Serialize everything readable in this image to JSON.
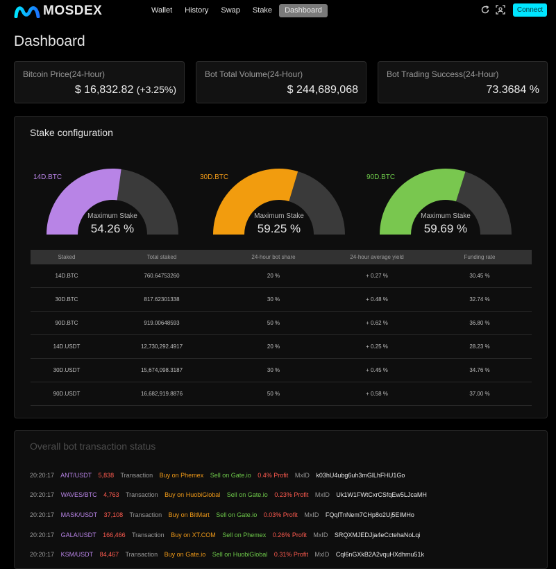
{
  "brand": {
    "name": "MOSDEX",
    "logo_icon": "m-wave-logo",
    "accent": "#00e5ff"
  },
  "nav": {
    "items": [
      "Wallet",
      "History",
      "Swap",
      "Stake",
      "Dashboard"
    ],
    "active": "Dashboard"
  },
  "header": {
    "refresh_icon": "refresh-icon",
    "scan_icon": "scan-icon",
    "connect_label": "Connect"
  },
  "page": {
    "title": "Dashboard"
  },
  "stats": {
    "bitcoin_price": {
      "label": "Bitcoin Price(24-Hour)",
      "value": "$ 16,832.82",
      "change": "(+3.25%)"
    },
    "bot_volume": {
      "label": "Bot Total Volume(24-Hour)",
      "value": "$ 244,689,068"
    },
    "bot_success": {
      "label": "Bot Trading Success(24-Hour)",
      "value": "73.3684 %"
    }
  },
  "stake": {
    "title": "Stake configuration",
    "caption": "Maximum Stake",
    "gauges": [
      {
        "label": "14D.BTC",
        "value": "54.26 %",
        "percent": 54.26,
        "color": "#b884e6"
      },
      {
        "label": "30D.BTC",
        "value": "59.25 %",
        "percent": 59.25,
        "color": "#f29c0e"
      },
      {
        "label": "90D.BTC",
        "value": "59.69 %",
        "percent": 59.69,
        "color": "#79c74f"
      }
    ],
    "gauge_track_color": "#3a3a3a",
    "columns": [
      "Staked",
      "Total staked",
      "24-hour bot share",
      "24-hour average yield",
      "Funding rate"
    ],
    "rows": [
      {
        "staked": "14D.BTC",
        "total": "760.64753260",
        "share": "20 %",
        "yield": "+ 0.27 %",
        "funding": "30.45 %",
        "color": "purple"
      },
      {
        "staked": "30D.BTC",
        "total": "817.62301338",
        "share": "30 %",
        "yield": "+ 0.48 %",
        "funding": "32.74 %",
        "color": "orange"
      },
      {
        "staked": "90D.BTC",
        "total": "919.00648593",
        "share": "50 %",
        "yield": "+ 0.62 %",
        "funding": "36.80 %",
        "color": "green"
      },
      {
        "staked": "14D.USDT",
        "total": "12,730,292.4917",
        "share": "20 %",
        "yield": "+ 0.25 %",
        "funding": "28.23 %",
        "color": "purple"
      },
      {
        "staked": "30D.USDT",
        "total": "15,674,098.3187",
        "share": "30 %",
        "yield": "+ 0.45 %",
        "funding": "34.76 %",
        "color": "orange"
      },
      {
        "staked": "90D.USDT",
        "total": "16,682,919.8876",
        "share": "50 %",
        "yield": "+ 0.58 %",
        "funding": "37.00 %",
        "color": "green"
      }
    ]
  },
  "transactions": {
    "title": "Overall bot transaction status",
    "rows": [
      {
        "time": "20:20:17",
        "pair": "ANT/USDT",
        "amount": "5,838",
        "type": "Transaction",
        "buy": "Buy on Phemex",
        "sell": "Sell on Gate.io",
        "profit": "0.4% Profit",
        "mx_label": "MxID",
        "mx_id": "k03hU4ubg6uh3mGlLhFHU1Go"
      },
      {
        "time": "20:20:17",
        "pair": "WAVES/BTC",
        "amount": "4,763",
        "type": "Transaction",
        "buy": "Buy on HuobiGlobal",
        "sell": "Sell on Gate.io",
        "profit": "0.23% Profit",
        "mx_label": "MxID",
        "mx_id": "Uk1W1FWtCxrCSfqEw5LJcaMH"
      },
      {
        "time": "20:20:17",
        "pair": "MASK/USDT",
        "amount": "37,108",
        "type": "Transaction",
        "buy": "Buy on BitMart",
        "sell": "Sell on Gate.io",
        "profit": "0.03% Profit",
        "mx_label": "MxID",
        "mx_id": "FQqlTnNem7CHp8o2Uj5EIMHo"
      },
      {
        "time": "20:20:17",
        "pair": "GALA/USDT",
        "amount": "166,466",
        "type": "Transaction",
        "buy": "Buy on XT.COM",
        "sell": "Sell on Phemex",
        "profit": "0.26% Profit",
        "mx_label": "MxID",
        "mx_id": "SRQXMJEDJja4eCctehaNoLqi"
      },
      {
        "time": "20:20:17",
        "pair": "KSM/USDT",
        "amount": "84,467",
        "type": "Transaction",
        "buy": "Buy on Gate.io",
        "sell": "Sell on HuobiGlobal",
        "profit": "0.31% Profit",
        "mx_label": "MxID",
        "mx_id": "Cql6nGXkB2A2vquHXdhmu51k"
      }
    ]
  }
}
